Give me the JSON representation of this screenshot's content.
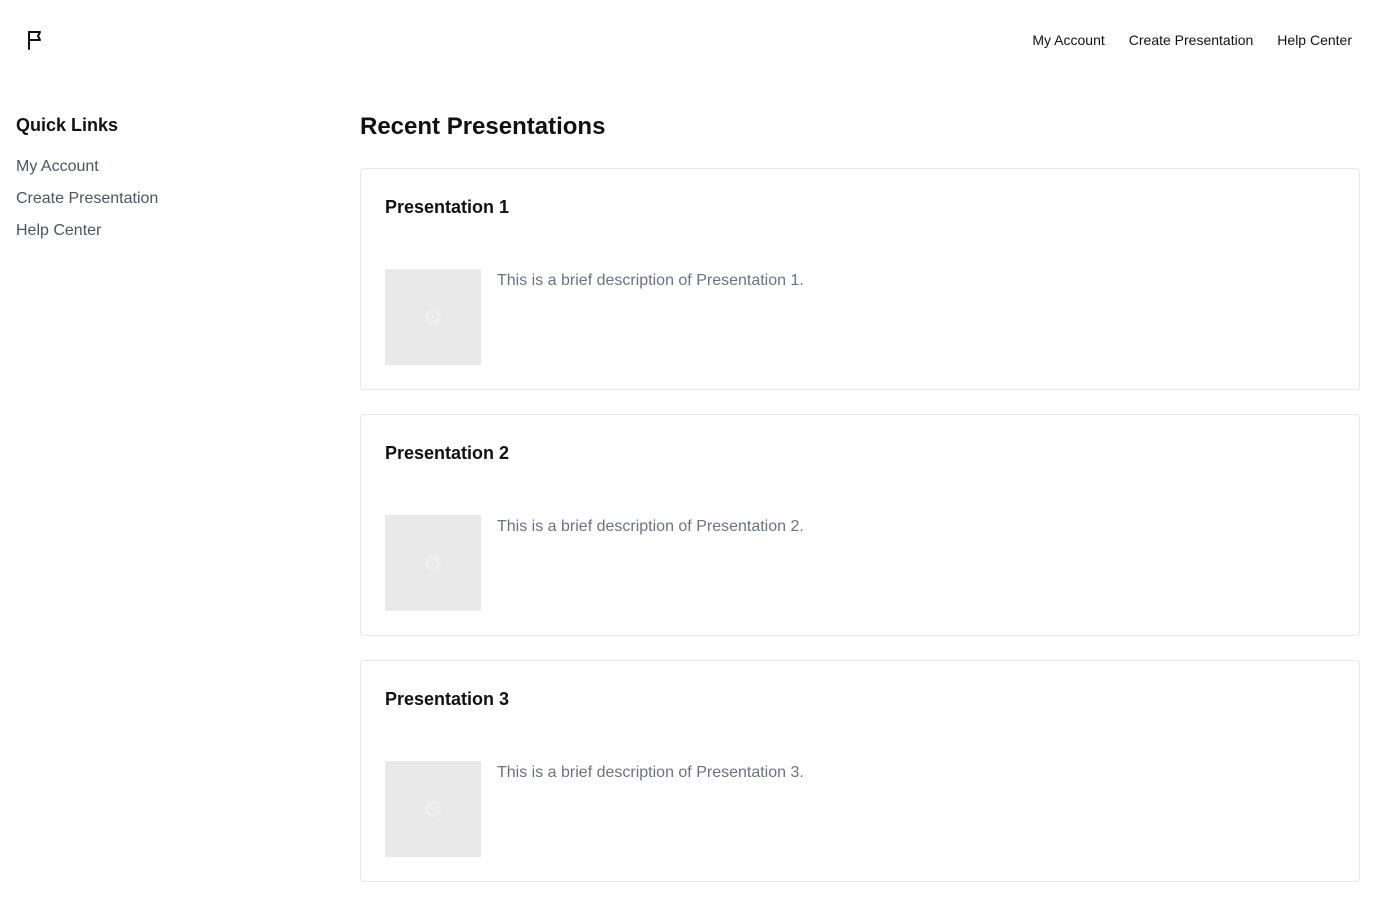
{
  "header": {
    "logo_icon": "flag-icon",
    "nav": [
      {
        "label": "My Account"
      },
      {
        "label": "Create Presentation"
      },
      {
        "label": "Help Center"
      }
    ]
  },
  "sidebar": {
    "title": "Quick Links",
    "links": [
      {
        "label": "My Account"
      },
      {
        "label": "Create Presentation"
      },
      {
        "label": "Help Center"
      }
    ]
  },
  "main": {
    "title": "Recent Presentations",
    "presentations": [
      {
        "title": "Presentation 1",
        "description": "This is a brief description of Presentation 1.",
        "thumbnail_icon": "image-placeholder-icon"
      },
      {
        "title": "Presentation 2",
        "description": "This is a brief description of Presentation 2.",
        "thumbnail_icon": "image-placeholder-icon"
      },
      {
        "title": "Presentation 3",
        "description": "This is a brief description of Presentation 3.",
        "thumbnail_icon": "image-placeholder-icon"
      }
    ]
  },
  "colors": {
    "text_primary": "#111111",
    "text_secondary": "#6b7280",
    "link_muted": "#4b5563",
    "card_border": "#e5e7eb",
    "thumbnail_bg": "#e9e9e9"
  }
}
